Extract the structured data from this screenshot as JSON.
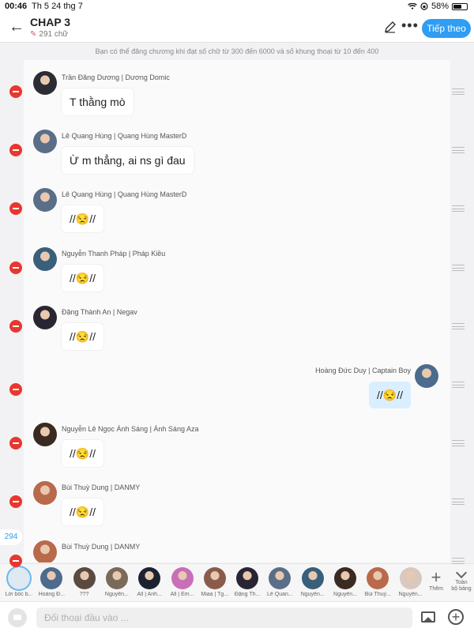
{
  "status_bar": {
    "time": "00:46",
    "date": "Th 5 24 thg 7",
    "battery": "58%",
    "battery_level": 0.58
  },
  "header": {
    "back_icon": "back-arrow-icon",
    "title": "CHAP 3",
    "word_count": "291 chữ",
    "next_label": "Tiếp theo"
  },
  "notice": "Bạn có thể đăng chương khi đạt số chữ từ 300 đến 6000 và số khung thoại từ 10 đến 400",
  "messages": [
    {
      "name": "Trần Đăng Dương | Dương Domic",
      "text": "T thằng mò",
      "mine": false,
      "avatar_color": "#2c2c35"
    },
    {
      "name": "Lê Quang Hùng | Quang Hùng MasterD",
      "text": "Ừ m thẳng, ai ns gì đau",
      "mine": false,
      "avatar_color": "#5a6f87"
    },
    {
      "name": "Lê Quang Hùng | Quang Hùng MasterD",
      "text": "//😒//",
      "mine": false,
      "avatar_color": "#5a6f87"
    },
    {
      "name": "Nguyễn Thanh Pháp | Pháp Kiều",
      "text": "//😒//",
      "mine": false,
      "avatar_color": "#3a5f7a"
    },
    {
      "name": "Đặng Thành An | Negav",
      "text": "//😒//",
      "mine": false,
      "avatar_color": "#2a2533"
    },
    {
      "name": "Hoàng Đức Duy | Captain Boy",
      "text": "//😒//",
      "mine": true,
      "avatar_color": "#4d6b8c"
    },
    {
      "name": "Nguyễn Lê Ngọc Ánh Sáng | Ánh Sáng Aza",
      "text": "//😒//",
      "mine": false,
      "avatar_color": "#3a2a22"
    },
    {
      "name": "Bùi Thuỳ Dung | DANMY",
      "text": "//😒//",
      "mine": false,
      "avatar_color": "#b96a4a"
    },
    {
      "name": "Bùi Thuỳ Dung | DANMY",
      "text": "",
      "mine": false,
      "avatar_color": "#b96a4a"
    }
  ],
  "dialog_count": "294",
  "characters": [
    {
      "label": "Lời bốc b...",
      "color": "#dfe9f2",
      "selected": true
    },
    {
      "label": "Hoàng Đ...",
      "color": "#4d6b8c",
      "selected": false
    },
    {
      "label": "???",
      "color": "#5b4a3f",
      "selected": false
    },
    {
      "label": "Nguyễn...",
      "color": "#7a6a5a",
      "selected": false
    },
    {
      "label": "All | Anh...",
      "color": "#1c2230",
      "selected": false
    },
    {
      "label": "All | Em...",
      "color": "#c86fb8",
      "selected": false
    },
    {
      "label": "Miaa | Tg...",
      "color": "#8a5a4a",
      "selected": false
    },
    {
      "label": "Đặng Th...",
      "color": "#2a2533",
      "selected": false
    },
    {
      "label": "Lê Quan...",
      "color": "#5a6f87",
      "selected": false
    },
    {
      "label": "Nguyễn...",
      "color": "#3a5f7a",
      "selected": false
    },
    {
      "label": "Nguyễn...",
      "color": "#3a2a22",
      "selected": false
    },
    {
      "label": "Bùi Thuỳ...",
      "color": "#b96a4a",
      "selected": false
    },
    {
      "label": "Nguyễn...",
      "color": "#d8c8c0",
      "selected": false
    }
  ],
  "more_characters_label": "Thêm",
  "fullscreen_label_1": "Toàn",
  "fullscreen_label_2": "bộ bảng",
  "input": {
    "placeholder": "Đối thoại đầu vào ..."
  },
  "accent_color": "#2f9df4"
}
